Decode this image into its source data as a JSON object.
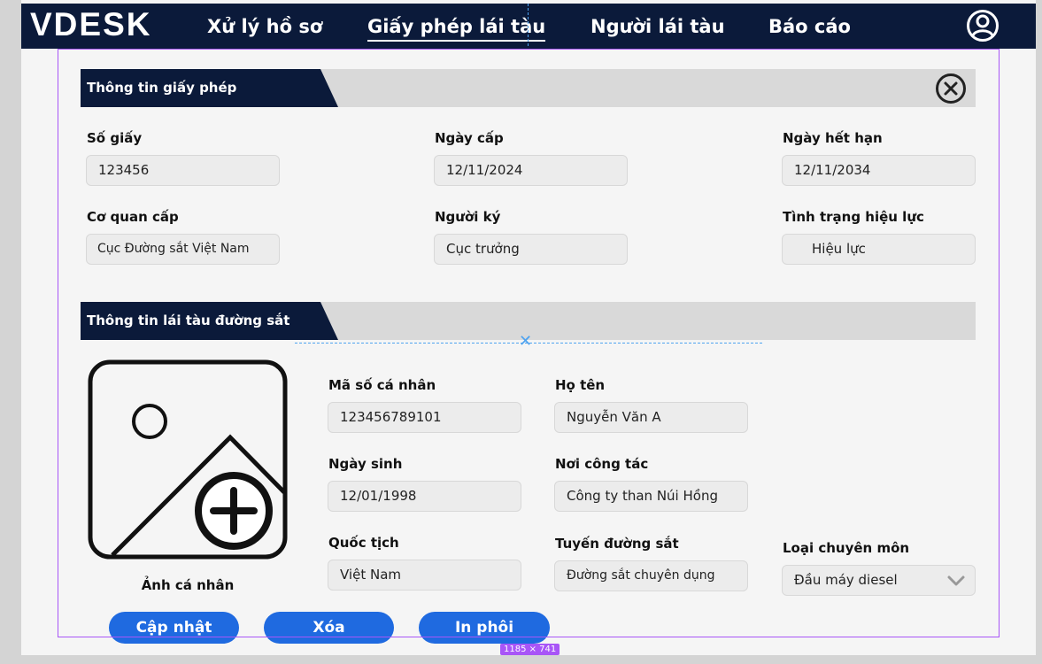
{
  "app": {
    "logo": "VDESK"
  },
  "nav": {
    "items": [
      "Xử lý hồ sơ",
      "Giấy phép lái tàu",
      "Người lái tàu",
      "Báo cáo"
    ],
    "active": "Giấy phép lái tàu"
  },
  "license_section": {
    "title": "Thông tin giấy phép",
    "fields": {
      "so_giay": {
        "label": "Số giấy",
        "value": "123456"
      },
      "ngay_cap": {
        "label": "Ngày cấp",
        "value": "12/11/2024"
      },
      "ngay_het_han": {
        "label": "Ngày hết hạn",
        "value": "12/11/2034"
      },
      "co_quan_cap": {
        "label": "Cơ quan cấp",
        "value": "Cục Đường sắt Việt Nam"
      },
      "nguoi_ky": {
        "label": "Người ký",
        "value": "Cục trưởng"
      },
      "tinh_trang": {
        "label": "Tình trạng hiệu lực",
        "value": "Hiệu lực"
      }
    }
  },
  "driver_section": {
    "title": "Thông tin lái tàu đường sắt",
    "photo_label": "Ảnh cá nhân",
    "fields": {
      "ma_so": {
        "label": "Mã số cá nhân",
        "value": "123456789101"
      },
      "ho_ten": {
        "label": "Họ tên",
        "value": "Nguyễn Văn A"
      },
      "ngay_sinh": {
        "label": "Ngày sinh",
        "value": "12/01/1998"
      },
      "noi_cong_tac": {
        "label": "Nơi công tác",
        "value": "Công ty than Núi Hồng"
      },
      "quoc_tich": {
        "label": "Quốc tịch",
        "value": "Việt Nam"
      },
      "tuyen_duong_sat": {
        "label": "Tuyến đường sắt",
        "value": "Đường sắt chuyên dụng"
      },
      "loai_chuyen_mon": {
        "label": "Loại chuyên môn",
        "value": "Đầu máy diesel"
      }
    }
  },
  "actions": {
    "update": "Cập nhật",
    "delete": "Xóa",
    "print": "In phôi"
  },
  "design_overlay": {
    "frame_size": "1185 × 741"
  },
  "colors": {
    "navy": "#0b1a3a",
    "button_blue": "#1f6ae0",
    "section_gray": "#d9d9d9",
    "selection_purple": "#a855f7"
  },
  "icons": {
    "user": "user-circle-icon",
    "close": "close-circle-icon",
    "photo": "image-add-icon",
    "dropdown": "chevron-down-icon"
  }
}
